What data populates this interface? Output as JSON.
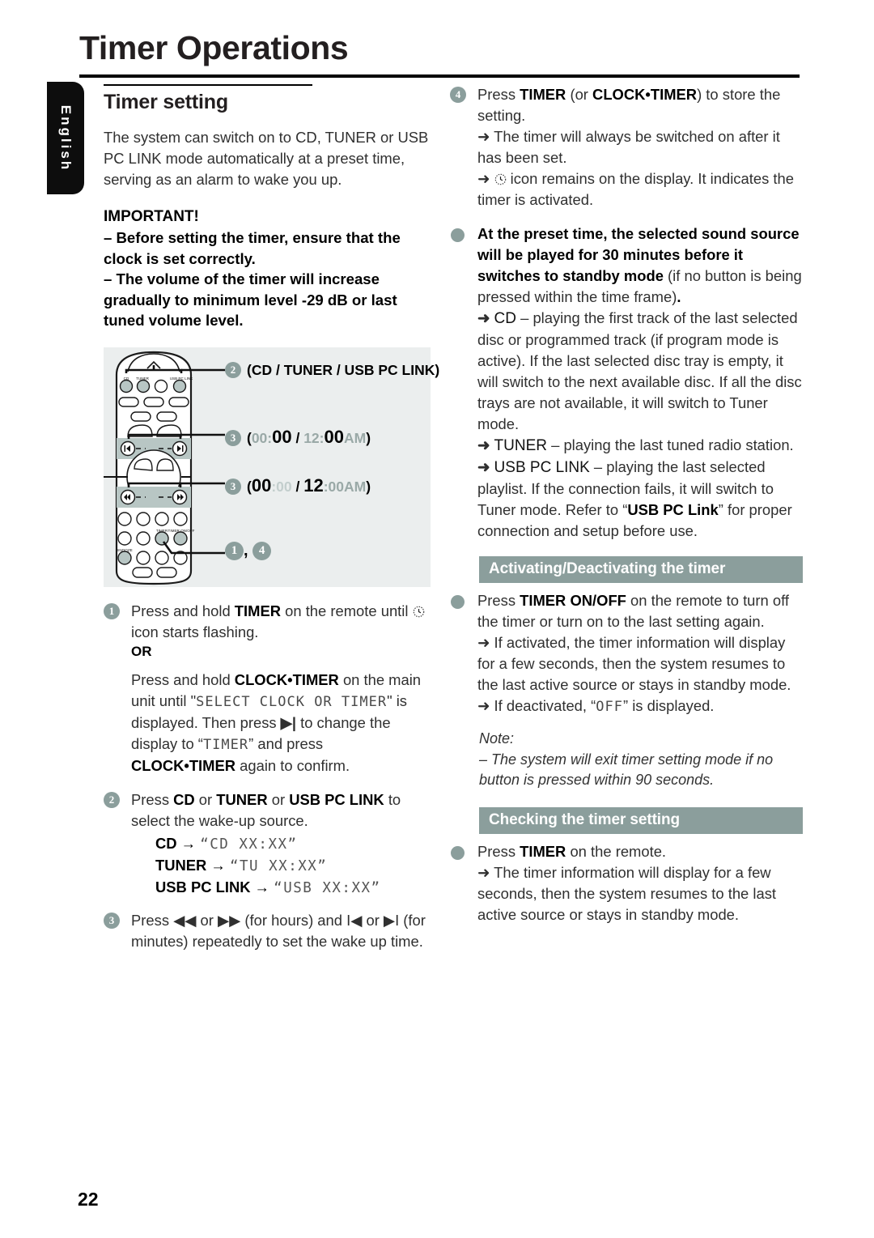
{
  "page": {
    "title": "Timer Operations",
    "language_tab": "English",
    "page_number": "22",
    "accent_color": "#8b9e9c",
    "figure_bg": "#ebeeee"
  },
  "left": {
    "section_title": "Timer setting",
    "intro": "The system can switch on to CD, TUNER or USB PC LINK mode automatically at a preset time, serving as an alarm to wake you up.",
    "important_head": "IMPORTANT!",
    "important_items": [
      "–  Before setting the timer, ensure that the clock is set correctly.",
      "–  The volume of the timer will increase gradually to minimum level -29 dB or last tuned volume level."
    ],
    "figure": {
      "name": "remote-control-diagram",
      "callouts": [
        {
          "num": "2",
          "text": "(CD / TUNER / USB PC LINK)"
        },
        {
          "num": "3",
          "time_a_gray": "00:",
          "time_a_black": "00",
          "sep": " / ",
          "time_b_gray": "12:",
          "time_b_black": "00",
          "time_b_suffix": "AM"
        },
        {
          "num": "3",
          "time_a_black": "00",
          "time_a_gray": ":00",
          "sep": " / ",
          "time_b_black": "12",
          "time_b_gray": ":00AM"
        },
        {
          "num": "1",
          "num2": "4",
          "text": ", "
        }
      ],
      "button_labels": [
        "CD",
        "TUNER",
        "USB PC LINK",
        "TIMER",
        "TIMER ON/OFF",
        "SNOOZE"
      ]
    },
    "steps": [
      {
        "num": "1",
        "line1_a": "Press and hold ",
        "line1_b": "TIMER",
        "line1_c": " on the remote until ",
        "line1_d": " icon starts flashing.",
        "or": "OR",
        "alt_a": "Press and hold ",
        "alt_b": "CLOCK•TIMER",
        "alt_c": " on the main unit until \"",
        "alt_lcd1": "SELECT CLOCK OR TIMER",
        "alt_d": "\" is displayed. Then press ",
        "alt_e": " to change the display to “",
        "alt_lcd2": "TIMER",
        "alt_f": "” and press ",
        "alt_g": "CLOCK•TIMER",
        "alt_h": " again to confirm."
      },
      {
        "num": "2",
        "text_a": "Press ",
        "b1": "CD",
        "t1": " or ",
        "b2": "TUNER",
        "t2": " or ",
        "b3": "USB PC LINK",
        "t3": " to select the wake-up source.",
        "sources": [
          {
            "label": "CD",
            "arrow": "→",
            "display": "“CD XX:XX”"
          },
          {
            "label": "TUNER",
            "arrow": "→",
            "display": "“TU XX:XX”"
          },
          {
            "label": "USB PC LINK",
            "arrow": "→",
            "display": "“USB XX:XX”"
          }
        ]
      },
      {
        "num": "3",
        "text": "Press ◀◀ or ▶▶ (for hours) and I◀ or ▶I (for minutes) repeatedly to set the wake up time."
      }
    ]
  },
  "right": {
    "step4": {
      "num": "4",
      "a": "Press ",
      "b": "TIMER",
      "c": " (or ",
      "d": "CLOCK•TIMER",
      "e": ") to store the setting.",
      "arrow1": "➜ The timer will always be switched on after it has been set.",
      "arrow2_a": "➜ ",
      "arrow2_b": " icon remains on the display. It indicates the timer is activated."
    },
    "preset": {
      "bold_a": "At the preset time, the selected sound source will be played for 30 minutes before it switches to standby mode",
      "normal_a": " (if no button is being pressed within the time frame)",
      "bold_b": ".",
      "cd_label": "CD",
      "cd_text": " – playing the first track of the last selected disc or programmed track (if program mode is active).  If the last selected disc tray is empty, it will switch to the next available disc.  If all the disc trays are not available, it will switch to Tuner mode.",
      "tuner_label": "TUNER",
      "tuner_text": " – playing the last tuned radio station.",
      "usb_label": "USB PC LINK",
      "usb_text_a": " – playing the last selected playlist.  If the connection fails, it will switch to Tuner mode.  Refer to “",
      "usb_bold": "USB PC Link",
      "usb_text_b": "” for proper connection and setup before use."
    },
    "activating": {
      "bar": "Activating/Deactivating the timer",
      "a": "Press ",
      "b": "TIMER ON/OFF",
      "c": " on the remote to turn off the timer or turn on to the last setting again.",
      "arrow1": "➜ If activated, the timer information will display for a few seconds, then the system resumes to the last active source or stays in standby mode.",
      "arrow2_a": "➜ If deactivated, “",
      "arrow2_lcd": "OFF",
      "arrow2_b": "” is displayed."
    },
    "note": {
      "head": "Note:",
      "body": "–  The system will exit timer setting mode if no button is pressed within 90 seconds."
    },
    "checking": {
      "bar": "Checking the timer setting",
      "a": "Press ",
      "b": "TIMER",
      "c": " on the remote.",
      "arrow1": "➜ The timer information will display for a few seconds, then the system resumes to the last active source or stays in standby mode."
    }
  }
}
